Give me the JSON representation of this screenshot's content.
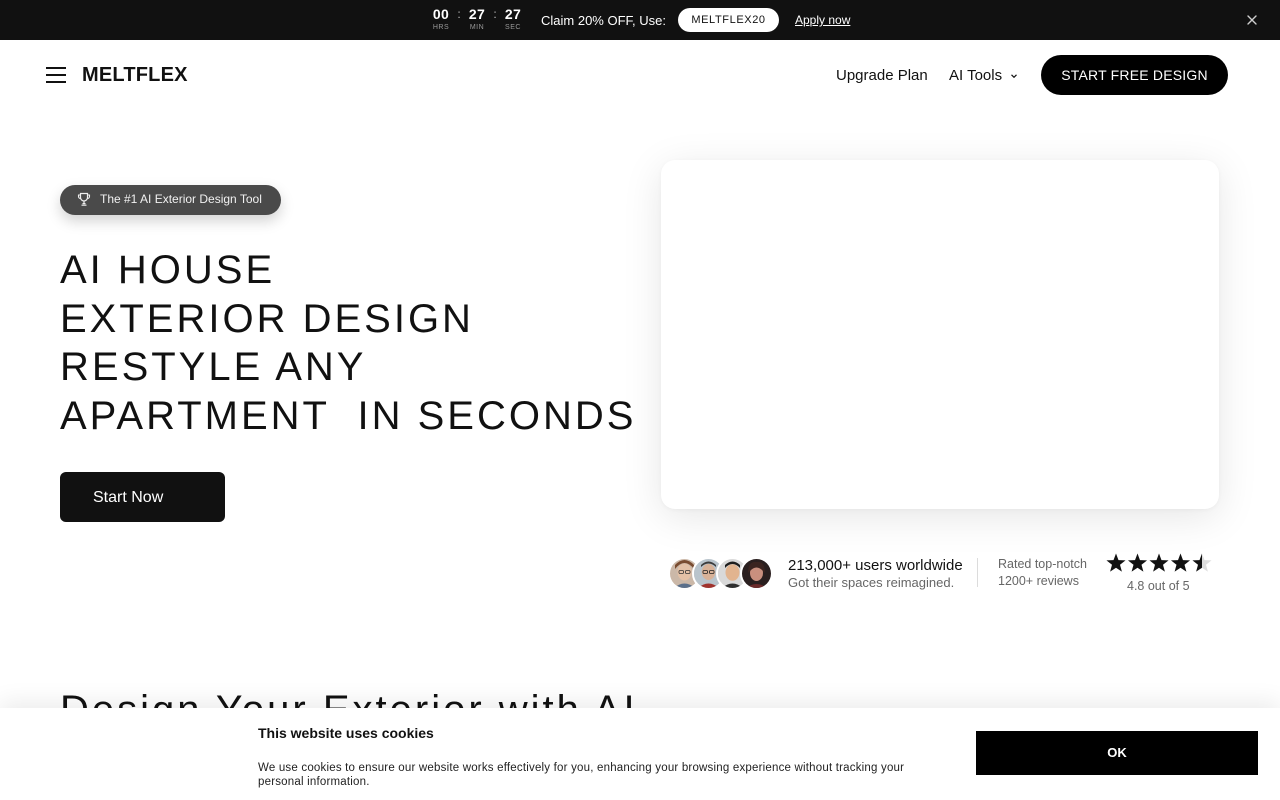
{
  "promo": {
    "timer": [
      {
        "value": "00",
        "label": "HRS"
      },
      {
        "value": "27",
        "label": "MIN"
      },
      {
        "value": "27",
        "label": "SEC"
      }
    ],
    "separator": ":",
    "text": "Claim 20% OFF, Use:",
    "code": "MELTFLEX20",
    "apply_label": "Apply now"
  },
  "header": {
    "logo": "MELTFLEX",
    "nav": {
      "upgrade": "Upgrade Plan",
      "ai_tools": "AI Tools"
    },
    "cta": "START FREE DESIGN"
  },
  "hero": {
    "badge": "The #1 AI Exterior Design Tool",
    "headline_lines": [
      "AI HOUSE",
      "EXTERIOR DESIGN",
      "RESTYLE ANY",
      "APARTMENT  IN SECONDS"
    ],
    "start_button": "Start Now"
  },
  "social_proof": {
    "users_main": "213,000+ users worldwide",
    "users_sub": "Got their spaces reimagined.",
    "rated_main": "Rated top-notch",
    "rated_sub": "1200+ reviews",
    "rating_value": 4.5,
    "rating_text": "4.8 out of 5"
  },
  "section": {
    "title": "Design Your Exterior with AI"
  },
  "cookie": {
    "title": "This website uses cookies",
    "text": "We use cookies to ensure our website works effectively for you, enhancing your browsing experience without tracking your personal information.",
    "ok_label": "OK"
  },
  "colors": {
    "promo_bg": "#111111",
    "badge_bg": "#4a4a4a",
    "button_dark": "#111111",
    "cta_black": "#000000"
  }
}
